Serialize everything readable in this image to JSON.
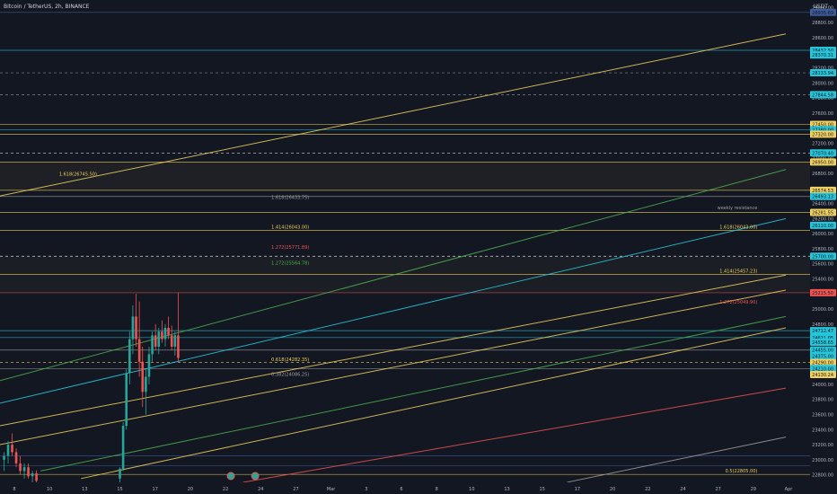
{
  "header": {
    "symbol": "Bitcoin / TetherUS, 2h, BINANCE",
    "currency": "USDT"
  },
  "colors": {
    "background": "#131722",
    "axis_text": "#b2b5be",
    "up": "#26a69a",
    "down": "#ef5350",
    "yellow": "#f0d060",
    "green": "#4caf50",
    "teal": "#26c6da",
    "red": "#c62828",
    "navy": "#3d5a99",
    "gray": "#9e9e9e"
  },
  "chart_data": {
    "type": "candlestick",
    "y_ticks": [
      "29000.00",
      "28800.00",
      "28600.00",
      "28400.00",
      "28200.00",
      "28000.00",
      "27800.00",
      "27600.00",
      "27400.00",
      "27200.00",
      "27000.00",
      "26800.00",
      "26600.00",
      "26400.00",
      "26200.00",
      "26000.00",
      "25800.00",
      "25600.00",
      "25400.00",
      "25200.00",
      "25000.00",
      "24800.00",
      "24600.00",
      "24400.00",
      "24200.00",
      "24000.00",
      "23800.00",
      "23600.00",
      "23400.00",
      "23200.00",
      "23000.00",
      "22800.00"
    ],
    "x_ticks": [
      "8",
      "10",
      "13",
      "15",
      "17",
      "20",
      "22",
      "24",
      "27",
      "Mar",
      "3",
      "6",
      "8",
      "10",
      "13",
      "15",
      "17",
      "20",
      "22",
      "24",
      "27",
      "29",
      "Apr"
    ],
    "y_range": [
      22700,
      29100
    ],
    "price_labels": [
      {
        "text": "28935.69",
        "price": 28935.69,
        "color": "#3d5a99"
      },
      {
        "text": "28432.50",
        "price": 28432.5,
        "color": "#26c6da"
      },
      {
        "text": "28370.31",
        "price": 28370.31,
        "color": "#26c6da"
      },
      {
        "text": "28133.94",
        "price": 28133.94,
        "color": "#26c6da"
      },
      {
        "text": "27844.58",
        "price": 27844.58,
        "color": "#26c6da"
      },
      {
        "text": "27450.00",
        "price": 27450.0,
        "color": "#f0d060"
      },
      {
        "text": "27380.00",
        "price": 27380.0,
        "color": "#26c6da"
      },
      {
        "text": "27320.00",
        "price": 27320.0,
        "color": "#f0d060"
      },
      {
        "text": "27070.40",
        "price": 27070.4,
        "color": "#26c6da"
      },
      {
        "text": "26950.00",
        "price": 26950.0,
        "color": "#f0d060"
      },
      {
        "text": "26574.53",
        "price": 26574.53,
        "color": "#f0d060"
      },
      {
        "text": "26493.13",
        "price": 26493.13,
        "color": "#26c6da"
      },
      {
        "text": "26281.55",
        "price": 26281.55,
        "color": "#f0d060"
      },
      {
        "text": "26110.00",
        "price": 26110.0,
        "color": "#26c6da"
      },
      {
        "text": "25700.00",
        "price": 25700.0,
        "color": "#26c6da"
      },
      {
        "text": "25215.50",
        "price": 25215.5,
        "color": "#ef5350"
      },
      {
        "text": "24712.47",
        "price": 24712.47,
        "color": "#26c6da"
      },
      {
        "text": "24621.05",
        "price": 24621.05,
        "color": "#26c6da"
      },
      {
        "text": "24558.65",
        "price": 24558.65,
        "color": "#26c6da"
      },
      {
        "text": "24455.00",
        "price": 24455.0,
        "color": "#26c6da"
      },
      {
        "text": "24375.00",
        "price": 24375.0,
        "color": "#26c6da"
      },
      {
        "text": "24290.00",
        "price": 24290.0,
        "color": "#f0d060"
      },
      {
        "text": "24210.00",
        "price": 24210.0,
        "color": "#26c6da"
      },
      {
        "text": "24130.24",
        "price": 24130.24,
        "color": "#f0d060"
      }
    ],
    "annotations": [
      {
        "text": "1.618(26745.50)",
        "price": 26745.5,
        "x_frac": 0.073,
        "color": "#f0d060"
      },
      {
        "text": "1.618(26433.75)",
        "price": 26433.75,
        "x_frac": 0.335,
        "color": "#9e9e9e"
      },
      {
        "text": "1.414(26043.00)",
        "price": 26043.0,
        "x_frac": 0.335,
        "color": "#f0d060"
      },
      {
        "text": "1.618(26043.00)",
        "price": 26043.0,
        "x_frac": 0.935,
        "color": "#f0d060"
      },
      {
        "text": "1.272(25771.89)",
        "price": 25771.89,
        "x_frac": 0.335,
        "color": "#ef5350"
      },
      {
        "text": "1.272(25564.78)",
        "price": 25564.78,
        "x_frac": 0.335,
        "color": "#4caf50"
      },
      {
        "text": "1.414(25457.23)",
        "price": 25457.23,
        "x_frac": 0.935,
        "color": "#f0d060"
      },
      {
        "text": "1.272(25049.90)",
        "price": 25049.9,
        "x_frac": 0.935,
        "color": "#ef5350"
      },
      {
        "text": "0.618(24282.35)",
        "price": 24282.35,
        "x_frac": 0.335,
        "color": "#f0d060"
      },
      {
        "text": "0.382(24086.25)",
        "price": 24086.25,
        "x_frac": 0.335,
        "color": "#9e9e9e"
      },
      {
        "text": "weekly resistance",
        "price": 26300.0,
        "x_frac": 0.935,
        "color": "#9e9e9e"
      },
      {
        "text": "0.5(22805.00)",
        "price": 22805.0,
        "x_frac": 0.935,
        "color": "#f0d060"
      }
    ],
    "candles": [
      {
        "x_frac": 0.005,
        "o": 23000,
        "h": 23100,
        "l": 22850,
        "c": 23050
      },
      {
        "x_frac": 0.01,
        "o": 23050,
        "h": 23250,
        "l": 22950,
        "c": 23200
      },
      {
        "x_frac": 0.015,
        "o": 23200,
        "h": 23350,
        "l": 23050,
        "c": 23100
      },
      {
        "x_frac": 0.02,
        "o": 23100,
        "h": 23150,
        "l": 22900,
        "c": 22950
      },
      {
        "x_frac": 0.025,
        "o": 22950,
        "h": 23050,
        "l": 22800,
        "c": 22850
      },
      {
        "x_frac": 0.03,
        "o": 22850,
        "h": 22950,
        "l": 22750,
        "c": 22900
      },
      {
        "x_frac": 0.035,
        "o": 22900,
        "h": 22950,
        "l": 22750,
        "c": 22780
      },
      {
        "x_frac": 0.04,
        "o": 22780,
        "h": 22850,
        "l": 22700,
        "c": 22820
      },
      {
        "x_frac": 0.045,
        "o": 22820,
        "h": 22860,
        "l": 22700,
        "c": 22720
      },
      {
        "x_frac": 0.148,
        "o": 22750,
        "h": 22900,
        "l": 22700,
        "c": 22880
      },
      {
        "x_frac": 0.152,
        "o": 22880,
        "h": 23500,
        "l": 22850,
        "c": 23450
      },
      {
        "x_frac": 0.156,
        "o": 23450,
        "h": 24200,
        "l": 23400,
        "c": 24150
      },
      {
        "x_frac": 0.16,
        "o": 24150,
        "h": 24700,
        "l": 24000,
        "c": 24600
      },
      {
        "x_frac": 0.164,
        "o": 24600,
        "h": 25050,
        "l": 24400,
        "c": 24900
      },
      {
        "x_frac": 0.168,
        "o": 24900,
        "h": 25200,
        "l": 24500,
        "c": 24600
      },
      {
        "x_frac": 0.172,
        "o": 24600,
        "h": 25100,
        "l": 24100,
        "c": 24300
      },
      {
        "x_frac": 0.176,
        "o": 24300,
        "h": 24500,
        "l": 23700,
        "c": 23900
      },
      {
        "x_frac": 0.18,
        "o": 23900,
        "h": 24200,
        "l": 23600,
        "c": 24100
      },
      {
        "x_frac": 0.184,
        "o": 24100,
        "h": 24500,
        "l": 24000,
        "c": 24400
      },
      {
        "x_frac": 0.188,
        "o": 24400,
        "h": 24700,
        "l": 24300,
        "c": 24650
      },
      {
        "x_frac": 0.192,
        "o": 24650,
        "h": 24800,
        "l": 24450,
        "c": 24500
      },
      {
        "x_frac": 0.196,
        "o": 24500,
        "h": 24750,
        "l": 24400,
        "c": 24700
      },
      {
        "x_frac": 0.2,
        "o": 24700,
        "h": 24850,
        "l": 24550,
        "c": 24600
      },
      {
        "x_frac": 0.204,
        "o": 24600,
        "h": 24800,
        "l": 24500,
        "c": 24750
      },
      {
        "x_frac": 0.208,
        "o": 24750,
        "h": 24900,
        "l": 24600,
        "c": 24650
      },
      {
        "x_frac": 0.212,
        "o": 24650,
        "h": 24780,
        "l": 24450,
        "c": 24500
      },
      {
        "x_frac": 0.216,
        "o": 24500,
        "h": 24700,
        "l": 24380,
        "c": 24650
      },
      {
        "x_frac": 0.22,
        "o": 24650,
        "h": 25220,
        "l": 24300,
        "c": 24350
      }
    ],
    "rays": [
      {
        "color": "#f0d060",
        "p1": [
          0.0,
          26500
        ],
        "p2": [
          0.97,
          28650
        ]
      },
      {
        "color": "#4caf50",
        "p1": [
          0.0,
          24050
        ],
        "p2": [
          0.97,
          26850
        ]
      },
      {
        "color": "#26c6da",
        "p1": [
          0.0,
          23750
        ],
        "p2": [
          0.97,
          26200
        ]
      },
      {
        "color": "#f0d060",
        "p1": [
          0.0,
          23450
        ],
        "p2": [
          0.97,
          25450
        ]
      },
      {
        "color": "#f0d060",
        "p1": [
          0.0,
          23200
        ],
        "p2": [
          0.97,
          25250
        ]
      },
      {
        "color": "#4caf50",
        "p1": [
          0.05,
          22850
        ],
        "p2": [
          0.97,
          24900
        ]
      },
      {
        "color": "#f0d060",
        "p1": [
          0.1,
          22750
        ],
        "p2": [
          0.97,
          24750
        ]
      },
      {
        "color": "#ef5350",
        "p1": [
          0.3,
          22700
        ],
        "p2": [
          0.97,
          23950
        ]
      },
      {
        "color": "#9e9e9e",
        "p1": [
          0.7,
          22700
        ],
        "p2": [
          0.97,
          23300
        ]
      }
    ],
    "hlines": [
      {
        "price": 28935.69,
        "color": "#3d5a99",
        "dash": false
      },
      {
        "price": 28432.5,
        "color": "#26c6da",
        "dash": false
      },
      {
        "price": 28133.94,
        "color": "#9e9e9e",
        "dash": true
      },
      {
        "price": 27844.58,
        "color": "#9e9e9e",
        "dash": true
      },
      {
        "price": 27450.0,
        "color": "#f0d060",
        "dash": false
      },
      {
        "price": 27380.0,
        "color": "#26c6da",
        "dash": false
      },
      {
        "price": 27320.0,
        "color": "#f0d060",
        "dash": false
      },
      {
        "price": 27070.4,
        "color": "#ffffff",
        "dash": true
      },
      {
        "price": 26950.0,
        "color": "#f0d060",
        "dash": false
      },
      {
        "price": 26574.53,
        "color": "#f0d060",
        "dash": false
      },
      {
        "price": 26493.13,
        "color": "#9e9e9e",
        "dash": false
      },
      {
        "price": 26281.55,
        "color": "#f0d060",
        "dash": false
      },
      {
        "price": 26043.0,
        "color": "#f0d060",
        "dash": false
      },
      {
        "price": 25700.0,
        "color": "#ffffff",
        "dash": true
      },
      {
        "price": 25457.23,
        "color": "#f0d060",
        "dash": false
      },
      {
        "price": 25215.5,
        "color": "#ef5350",
        "dash": false
      },
      {
        "price": 24712.47,
        "color": "#26c6da",
        "dash": false
      },
      {
        "price": 24621.05,
        "color": "#26c6da",
        "dash": false
      },
      {
        "price": 24455.0,
        "color": "#9e9e9e",
        "dash": false
      },
      {
        "price": 24290.0,
        "color": "#f0d060",
        "dash": true
      },
      {
        "price": 24210.0,
        "color": "#9e9e9e",
        "dash": false
      },
      {
        "price": 23050.0,
        "color": "#3d5a99",
        "dash": false
      },
      {
        "price": 22920.0,
        "color": "#3d5a99",
        "dash": false
      },
      {
        "price": 22805.0,
        "color": "#f0d060",
        "dash": false
      }
    ]
  }
}
